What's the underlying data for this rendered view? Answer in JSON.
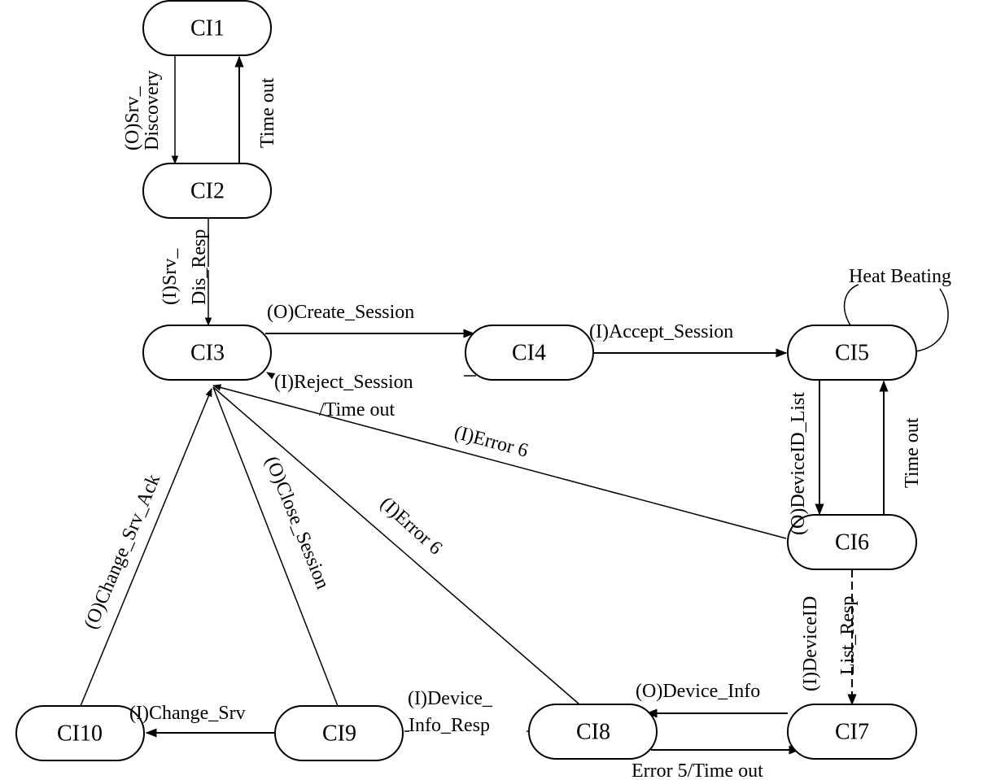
{
  "diagram": {
    "type": "state-transition",
    "nodes": [
      {
        "id": "CI1",
        "label": "CI1"
      },
      {
        "id": "CI2",
        "label": "CI2"
      },
      {
        "id": "CI3",
        "label": "CI3"
      },
      {
        "id": "CI4",
        "label": "CI4"
      },
      {
        "id": "CI5",
        "label": "CI5"
      },
      {
        "id": "CI6",
        "label": "CI6"
      },
      {
        "id": "CI7",
        "label": "CI7"
      },
      {
        "id": "CI8",
        "label": "CI8"
      },
      {
        "id": "CI9",
        "label": "CI9"
      },
      {
        "id": "CI10",
        "label": "CI10"
      }
    ],
    "edges": [
      {
        "from": "CI1",
        "to": "CI2",
        "label_lines": [
          "(O)Srv_",
          "Discovery"
        ]
      },
      {
        "from": "CI2",
        "to": "CI1",
        "label_lines": [
          "Time out"
        ]
      },
      {
        "from": "CI2",
        "to": "CI3",
        "label_lines": [
          "(I)Srv_",
          "Dis_Resp"
        ]
      },
      {
        "from": "CI3",
        "to": "CI4",
        "label_lines": [
          "(O)Create_Session"
        ]
      },
      {
        "from": "CI4",
        "to": "CI3",
        "label_lines": [
          "(I)Reject_Session",
          "/Time out"
        ]
      },
      {
        "from": "CI4",
        "to": "CI5",
        "label_lines": [
          "(I)Accept_Session"
        ]
      },
      {
        "from": "CI5",
        "to": "CI5",
        "label_lines": [
          "Heat Beating"
        ]
      },
      {
        "from": "CI5",
        "to": "CI6",
        "label_lines": [
          "(O)DeviceID_List"
        ]
      },
      {
        "from": "CI6",
        "to": "CI5",
        "label_lines": [
          "Time out"
        ]
      },
      {
        "from": "CI6",
        "to": "CI3",
        "label_lines": [
          "(I)Error 6"
        ]
      },
      {
        "from": "CI6",
        "to": "CI7",
        "label_lines": [
          "(I)DeviceID",
          "List_Resp"
        ]
      },
      {
        "from": "CI7",
        "to": "CI8",
        "label_lines": [
          "(O)Device_Info"
        ]
      },
      {
        "from": "CI8",
        "to": "CI7",
        "label_lines": [
          "Error 5/Time out"
        ]
      },
      {
        "from": "CI8",
        "to": "CI3",
        "label_lines": [
          "(I)Error 6"
        ]
      },
      {
        "from": "CI8",
        "to": "CI9",
        "label_lines": [
          "(I)Device_",
          "Info_Resp"
        ]
      },
      {
        "from": "CI9",
        "to": "CI3",
        "label_lines": [
          "(O)Close_Session"
        ]
      },
      {
        "from": "CI9",
        "to": "CI10",
        "label_lines": [
          "(I)Change_Srv"
        ]
      },
      {
        "from": "CI10",
        "to": "CI3",
        "label_lines": [
          "(O)Change_Srv_Ack"
        ]
      }
    ]
  }
}
